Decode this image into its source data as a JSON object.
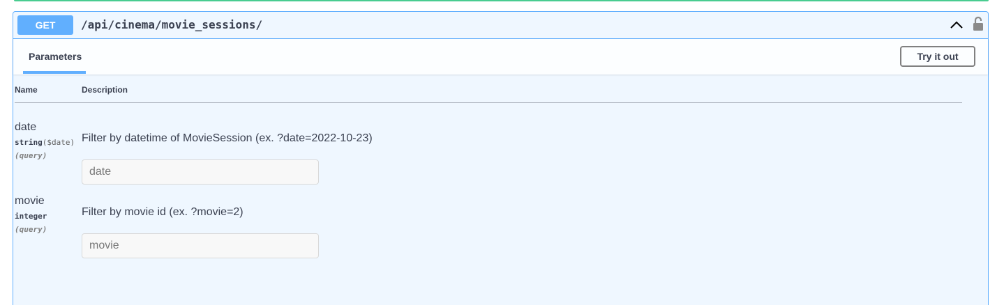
{
  "operation": {
    "method": "GET",
    "path": "/api/cinema/movie_sessions/"
  },
  "section": {
    "tab_label": "Parameters",
    "try_button_label": "Try it out"
  },
  "table": {
    "headers": {
      "name": "Name",
      "description": "Description"
    },
    "params": [
      {
        "name": "date",
        "type": "string",
        "format": "($date)",
        "in": "(query)",
        "description": "Filter by datetime of MovieSession (ex. ?date=2022-10-23)",
        "placeholder": "date"
      },
      {
        "name": "movie",
        "type": "integer",
        "format": "",
        "in": "(query)",
        "description": "Filter by movie id (ex. ?movie=2)",
        "placeholder": "movie"
      }
    ]
  },
  "icons": {
    "collapse": "chevron-up-icon",
    "lock": "lock-icon"
  },
  "colors": {
    "get_method": "#61affe",
    "border": "#61affe",
    "previous_block": "#49cc90"
  }
}
